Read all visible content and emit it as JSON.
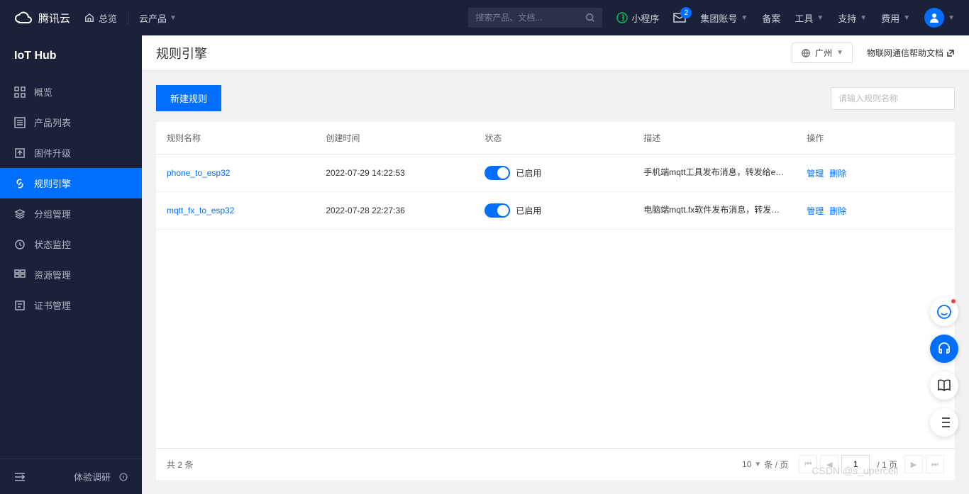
{
  "header": {
    "brand": "腾讯云",
    "overview": "总览",
    "products": "云产品",
    "search_placeholder": "搜索产品、文档...",
    "miniprogram": "小程序",
    "badge_count": "2",
    "account": "集团账号",
    "filing": "备案",
    "tools": "工具",
    "support": "支持",
    "billing": "费用"
  },
  "sidebar": {
    "product": "IoT Hub",
    "items": [
      {
        "label": "概览"
      },
      {
        "label": "产品列表"
      },
      {
        "label": "固件升级"
      },
      {
        "label": "规则引擎"
      },
      {
        "label": "分组管理"
      },
      {
        "label": "状态监控"
      },
      {
        "label": "资源管理"
      },
      {
        "label": "证书管理"
      }
    ],
    "survey": "体验调研"
  },
  "main": {
    "title": "规则引擎",
    "region": "广州",
    "help": "物联网通信帮助文档",
    "new_rule": "新建规则",
    "search_placeholder": "请输入规则名称"
  },
  "table": {
    "cols": {
      "name": "规则名称",
      "time": "创建时间",
      "status": "状态",
      "desc": "描述",
      "ops": "操作"
    },
    "rows": [
      {
        "name": "phone_to_esp32",
        "time": "2022-07-29 14:22:53",
        "status": "已启用",
        "desc": "手机端mqtt工具发布消息，转发给es..."
      },
      {
        "name": "mqtt_fx_to_esp32",
        "time": "2022-07-28 22:27:36",
        "status": "已启用",
        "desc": "电脑端mqtt.fx软件发布消息，转发给..."
      }
    ],
    "actions": {
      "manage": "管理",
      "delete": "删除"
    }
  },
  "pagination": {
    "total_prefix": "共 ",
    "total_count": "2",
    "total_suffix": " 条",
    "page_size": "10",
    "per_page": "条 / 页",
    "current": "1",
    "total_pages": "/ 1 页"
  },
  "watermark": "CSDN @s_upercell"
}
